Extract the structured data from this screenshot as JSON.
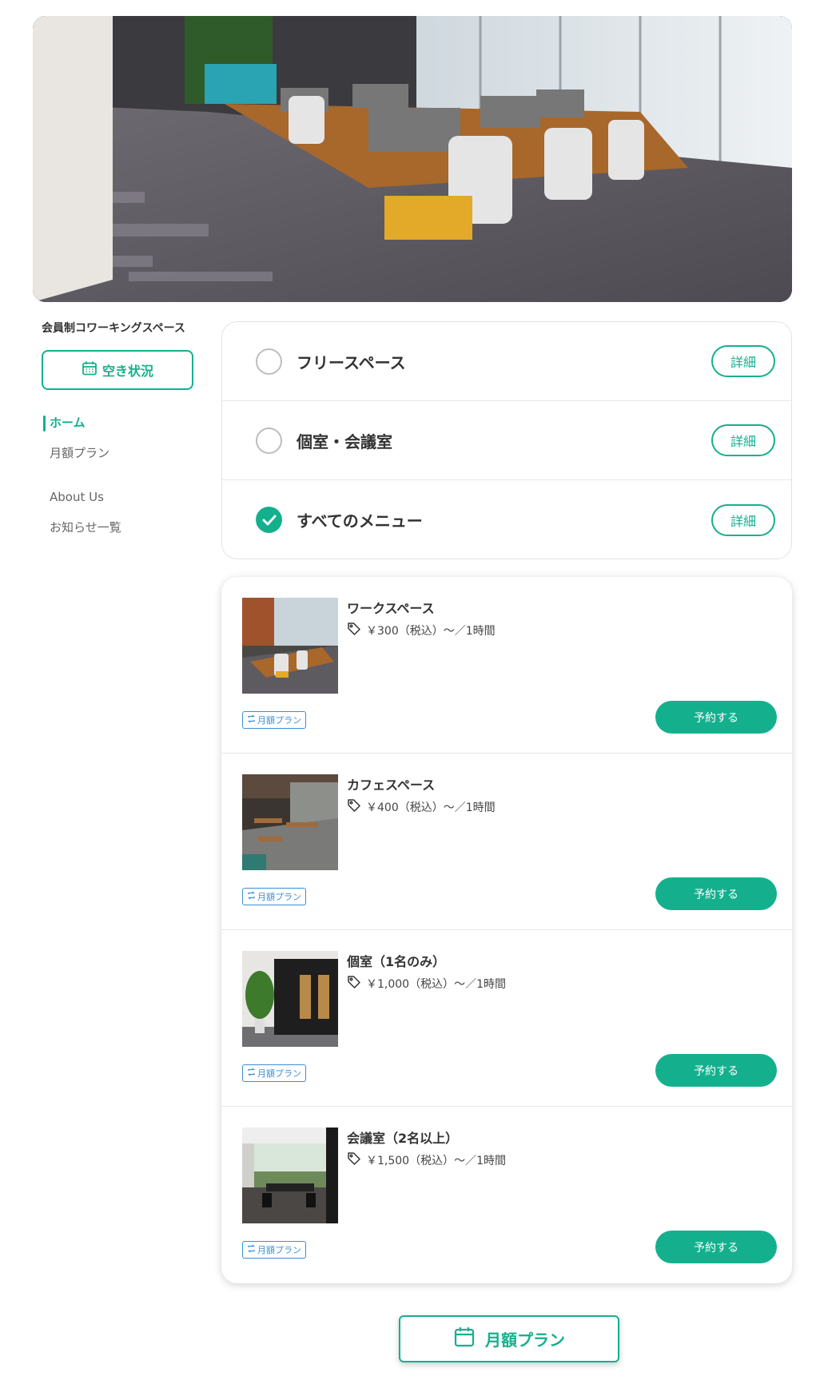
{
  "hero": {
    "image": "coworking-office-photo"
  },
  "sidebar": {
    "shop_name": "会員制コワーキングスペース",
    "availability_button": "空き状況",
    "nav": [
      {
        "label": "ホーム",
        "active": true
      },
      {
        "label": "月額プラン",
        "active": false
      },
      {
        "label": "About Us",
        "active": false
      },
      {
        "label": "お知らせ一覧",
        "active": false
      }
    ]
  },
  "categories": [
    {
      "label": "フリースペース",
      "checked": false,
      "detail": "詳細"
    },
    {
      "label": "個室・会議室",
      "checked": false,
      "detail": "詳細"
    },
    {
      "label": "すべてのメニュー",
      "checked": true,
      "detail": "詳細"
    }
  ],
  "menu_items": [
    {
      "name": "ワークスペース",
      "price": "￥300（税込）〜／1時間",
      "badge": "月額プラン",
      "reserve": "予約する",
      "thumb": "workspace-photo"
    },
    {
      "name": "カフェスペース",
      "price": "￥400（税込）〜／1時間",
      "badge": "月額プラン",
      "reserve": "予約する",
      "thumb": "cafe-photo"
    },
    {
      "name": "個室（1名のみ）",
      "price": "￥1,000（税込）〜／1時間",
      "badge": "月額プラン",
      "reserve": "予約する",
      "thumb": "private-room-photo"
    },
    {
      "name": "会議室（2名以上）",
      "price": "￥1,500（税込）〜／1時間",
      "badge": "月額プラン",
      "reserve": "予約する",
      "thumb": "meeting-room-photo"
    }
  ],
  "monthly_button": "月額プラン",
  "colors": {
    "accent": "#14b08e",
    "badge": "#3a8fd6"
  }
}
